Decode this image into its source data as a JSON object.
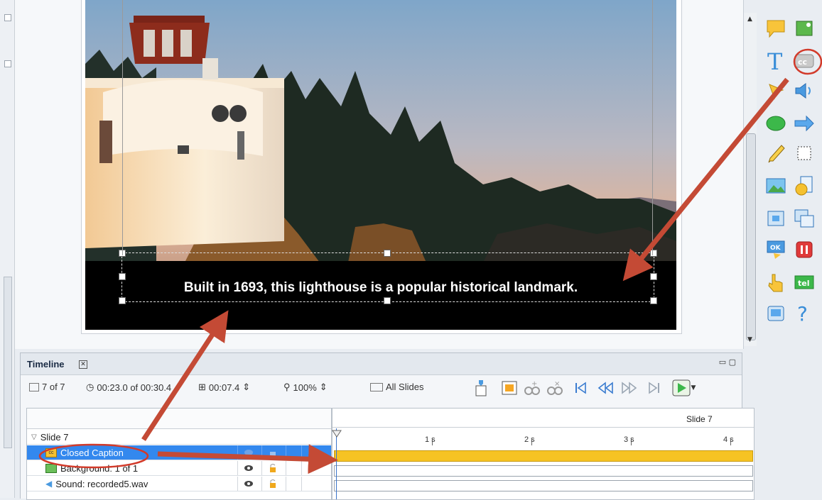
{
  "stage": {
    "caption_text": "Built in 1693, this lighthouse is a popular historical landmark."
  },
  "timeline": {
    "title": "Timeline",
    "slide_counter": "7 of 7",
    "current_time": "00:23.0 of 00:30.4",
    "duration": "00:07.4",
    "zoom": "100%",
    "all_slides_label": "All Slides",
    "ruler_slide_label": "Slide 7",
    "ticks": [
      "1 s",
      "2 s",
      "3 s",
      "4 s"
    ],
    "layers": [
      {
        "name": "Slide 7",
        "type": "slide-group"
      },
      {
        "name": "Closed Caption",
        "type": "closed-caption",
        "selected": true
      },
      {
        "name": "Background: 1 of 1",
        "type": "background"
      },
      {
        "name": "Sound: recorded5.wav",
        "type": "sound"
      }
    ]
  },
  "toolbar": {
    "tools": [
      "speech-bubble-icon",
      "image-edit-icon",
      "text-icon",
      "closed-caption-icon",
      "pointer-star-icon",
      "speaker-icon",
      "highlight-shape-icon",
      "arrow-icon",
      "pencil-icon",
      "selection-box-icon",
      "image-icon",
      "film-reel-icon",
      "zoom-area-icon",
      "zoom-dest-icon",
      "button-ok-icon",
      "stop-icon",
      "click-hand-icon",
      "text-entry-icon",
      "screen-icon",
      "help-icon"
    ],
    "cc_label": "cc",
    "text_entry_label": "tel"
  },
  "colors": {
    "selection": "#3388ee",
    "caption_bar": "#f6c323",
    "annotation": "#c44a35"
  }
}
